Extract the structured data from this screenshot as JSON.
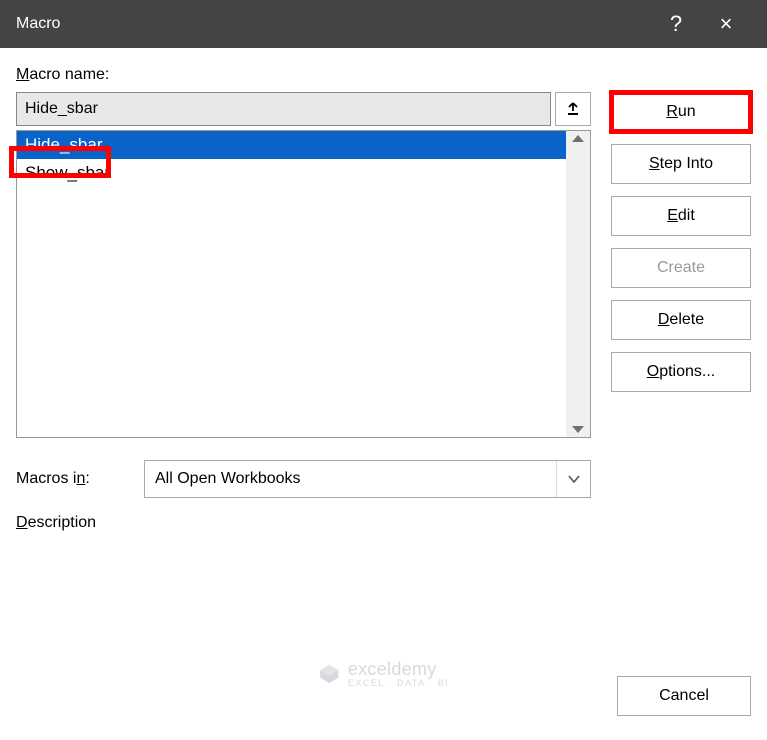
{
  "titlebar": {
    "title": "Macro",
    "help": "?",
    "close": "×"
  },
  "labels": {
    "macro_name_prefix": "M",
    "macro_name_rest": "acro name:",
    "macros_in": "Macros i",
    "macros_in_suffix": "n:",
    "description_prefix": "D",
    "description_rest": "escription"
  },
  "input": {
    "value": "Hide_sbar"
  },
  "list": {
    "items": [
      {
        "label": "Hide_sbar",
        "selected": true
      },
      {
        "label": "Show_sbar",
        "selected": false
      }
    ]
  },
  "macros_in": {
    "value": "All Open Workbooks"
  },
  "buttons": {
    "run_prefix": "R",
    "run_rest": "un",
    "step_into_prefix": "S",
    "step_into_rest": "tep Into",
    "edit_prefix": "E",
    "edit_rest": "dit",
    "create": "Create",
    "delete_prefix": "D",
    "delete_rest": "elete",
    "options_prefix": "O",
    "options_rest": "ptions...",
    "cancel": "Cancel"
  },
  "watermark": {
    "brand": "exceldemy",
    "tagline": "EXCEL · DATA · BI"
  }
}
